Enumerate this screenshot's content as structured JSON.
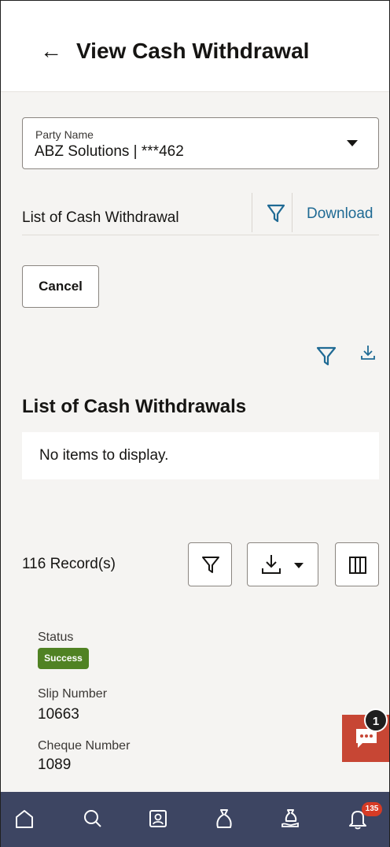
{
  "header": {
    "back_icon": "arrow-left-icon",
    "title": "View Cash Withdrawal"
  },
  "party": {
    "label": "Party Name",
    "value": "ABZ Solutions | ***462"
  },
  "list_toolbar": {
    "label": "List of Cash Withdrawal",
    "download": "Download"
  },
  "actions": {
    "cancel": "Cancel"
  },
  "section": {
    "title": "List of Cash Withdrawals",
    "empty_text": "No items to display."
  },
  "records": {
    "count_text": "116 Record(s)"
  },
  "card": {
    "status_label": "Status",
    "status_value": "Success",
    "slip_label": "Slip Number",
    "slip_value": "10663",
    "cheque_label": "Cheque Number",
    "cheque_value": "1089"
  },
  "chat": {
    "count": "1"
  },
  "bottom_nav": {
    "items": [
      "home-icon",
      "search-icon",
      "id-card-icon",
      "bag-icon",
      "hand-bag-icon",
      "bell-icon"
    ],
    "notification_count": "135"
  },
  "colors": {
    "accent": "#1f6a94",
    "success": "#508223",
    "chat": "#c74634",
    "nav": "#3d4562",
    "badge": "#d63b25"
  }
}
